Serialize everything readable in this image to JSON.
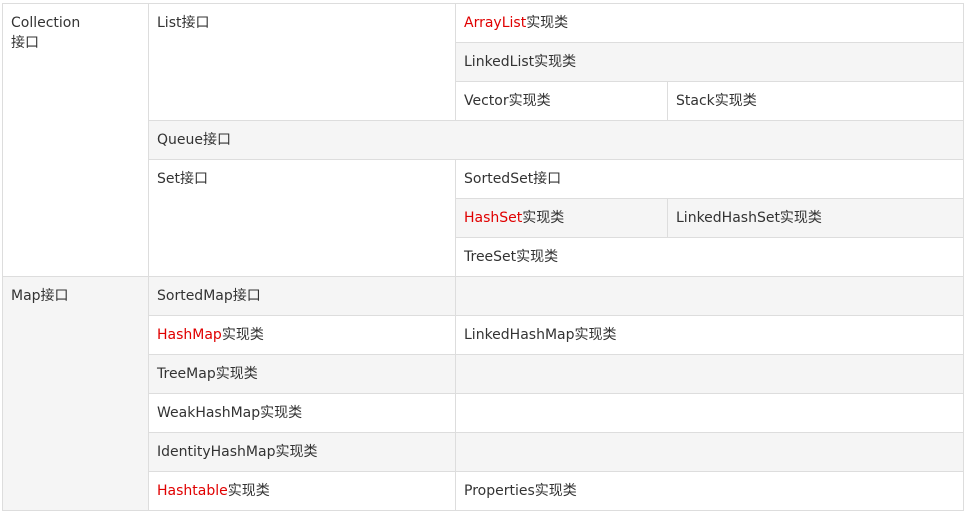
{
  "colors": {
    "highlight": "#e00000",
    "border": "#dddddd",
    "shade": "#f5f5f5",
    "text": "#333333"
  },
  "collection": {
    "label_line1": "Collection",
    "label_line2": "接口",
    "list": {
      "label": "List接口",
      "arraylist": {
        "name": "ArrayList",
        "suffix": "实现类"
      },
      "linkedlist": "LinkedList实现类",
      "vector": "Vector实现类",
      "stack": "Stack实现类"
    },
    "queue": {
      "label": "Queue接口"
    },
    "set": {
      "label": "Set接口",
      "sortedset": "SortedSet接口",
      "hashset": {
        "name": "HashSet",
        "suffix": "实现类"
      },
      "linkedhashset": "LinkedHashSet实现类",
      "treeset": "TreeSet实现类"
    }
  },
  "map": {
    "label": "Map接口",
    "sortedmap": "SortedMap接口",
    "hashmap": {
      "name": "HashMap",
      "suffix": "实现类"
    },
    "linkedhashmap": "LinkedHashMap实现类",
    "treemap": "TreeMap实现类",
    "weakhashmap": "WeakHashMap实现类",
    "identityhashmap": "IdentityHashMap实现类",
    "hashtable": {
      "name": "Hashtable",
      "suffix": "实现类"
    },
    "properties": "Properties实现类"
  }
}
